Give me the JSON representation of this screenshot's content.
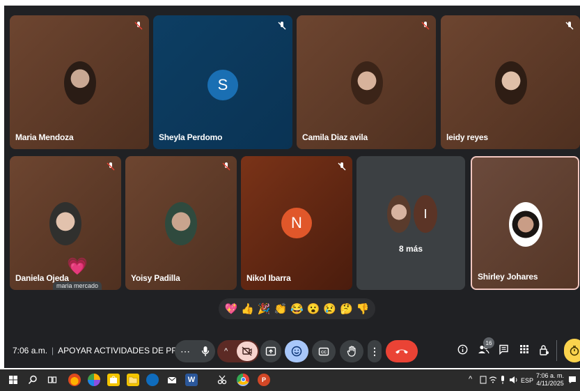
{
  "participants": [
    {
      "name": "Maria Mendoza",
      "type": "photo"
    },
    {
      "name": "Sheyla Perdomo",
      "type": "letter",
      "initial": "S"
    },
    {
      "name": "Camila Diaz avila",
      "type": "photo"
    },
    {
      "name": "leidy reyes",
      "type": "photo"
    },
    {
      "name": "Daniela Ojeda",
      "type": "photo"
    },
    {
      "name": "Yoisy Padilla",
      "type": "photo"
    },
    {
      "name": "Nikol Ibarra",
      "type": "letter",
      "initial": "N"
    },
    {
      "name": "Shirley Johares",
      "type": "photo"
    }
  ],
  "overflow": {
    "initial": "I",
    "label": "8 más"
  },
  "floating_reaction": {
    "emoji": "💗",
    "sender": "maria mercado"
  },
  "reactions": [
    "💖",
    "👍",
    "🎉",
    "👏",
    "😂",
    "😮",
    "😢",
    "🤔",
    "👎"
  ],
  "meeting": {
    "time": "7:06 a.m.",
    "title": "APOYAR ACTIVIDADES DE PROM..."
  },
  "people_count": "16",
  "taskbar": {
    "time": "7:06 a. m.",
    "date": "4/11/2025",
    "lang": "ESP"
  },
  "colors": {
    "end_call": "#ea4335",
    "active_blue": "#a8c7fa",
    "camera_off": "#f6d3ce",
    "highlight_yellow": "#fbd34d"
  }
}
